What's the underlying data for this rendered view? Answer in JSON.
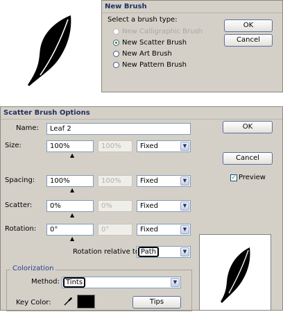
{
  "new_brush": {
    "title": "New Brush",
    "prompt": "Select a brush type:",
    "options": [
      {
        "label": "New Calligraphic Brush",
        "enabled": false,
        "selected": false
      },
      {
        "label": "New Scatter Brush",
        "enabled": true,
        "selected": true
      },
      {
        "label": "New Art Brush",
        "enabled": true,
        "selected": false
      },
      {
        "label": "New Pattern Brush",
        "enabled": true,
        "selected": false
      }
    ],
    "ok_label": "OK",
    "cancel_label": "Cancel"
  },
  "scatter": {
    "title": "Scatter Brush Options",
    "name_label": "Name:",
    "name_value": "Leaf 2",
    "rows": [
      {
        "label": "Size:",
        "value": "100%",
        "value2": "100%",
        "mode": "Fixed"
      },
      {
        "label": "Spacing:",
        "value": "100%",
        "value2": "100%",
        "mode": "Fixed"
      },
      {
        "label": "Scatter:",
        "value": "0%",
        "value2": "0%",
        "mode": "Fixed"
      },
      {
        "label": "Rotation:",
        "value": "0°",
        "value2": "0°",
        "mode": "Fixed"
      }
    ],
    "rotation_relative_label": "Rotation relative to:",
    "rotation_relative_value": "Path",
    "ok_label": "OK",
    "cancel_label": "Cancel",
    "preview_label": "Preview",
    "preview_checked": true,
    "colorization": {
      "group_label": "Colorization",
      "method_label": "Method:",
      "method_value": "Tints",
      "key_color_label": "Key Color:",
      "key_color": "#000000",
      "tips_label": "Tips"
    }
  },
  "icons": {
    "leaf": "leaf-icon",
    "eyedropper": "eyedropper-icon",
    "dropdown": "chevron-down-icon"
  },
  "colors": {
    "dialog_bg": "#d4d0c8",
    "accent_border": "#5b6e9e",
    "title_text": "#1f2f5f"
  }
}
